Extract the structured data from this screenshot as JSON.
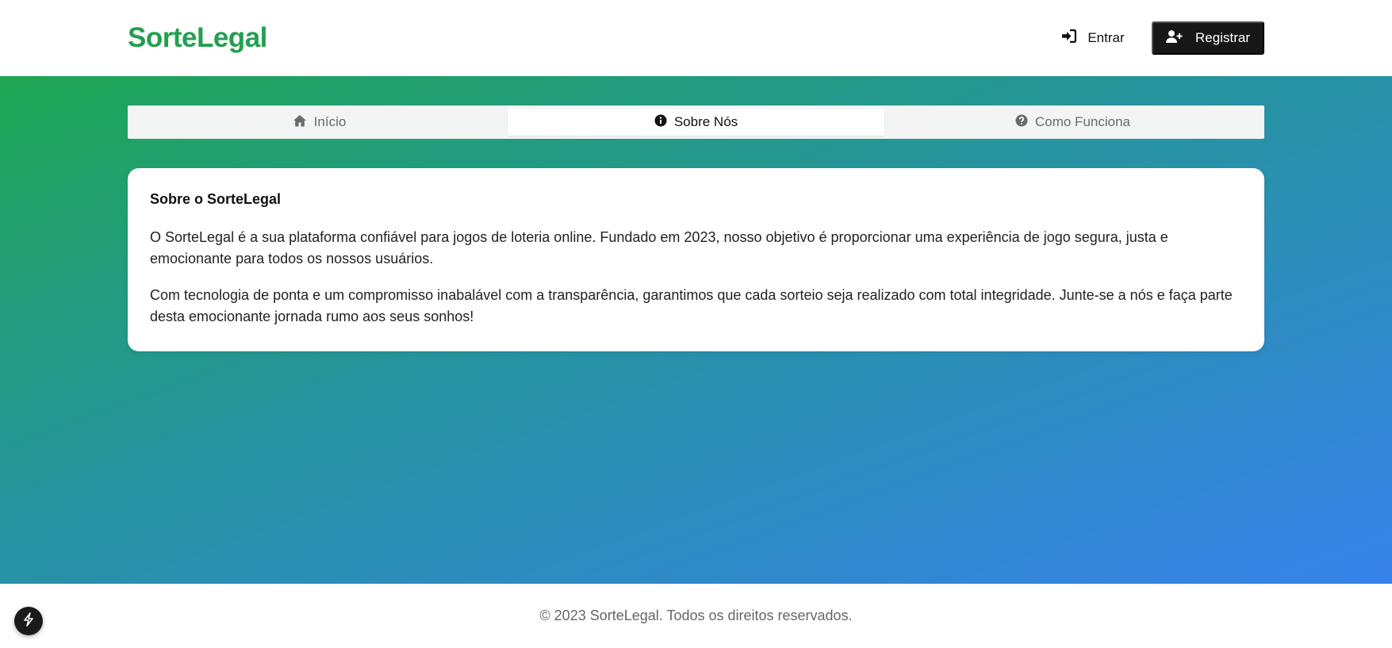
{
  "header": {
    "logo": "SorteLegal",
    "login_label": "Entrar",
    "register_label": "Registrar"
  },
  "tabs": [
    {
      "label": "Início",
      "icon": "home-icon",
      "active": false
    },
    {
      "label": "Sobre Nós",
      "icon": "info-icon",
      "active": true
    },
    {
      "label": "Como Funciona",
      "icon": "question-icon",
      "active": false
    }
  ],
  "card": {
    "title": "Sobre o SorteLegal",
    "paragraphs": [
      "O SorteLegal é a sua plataforma confiável para jogos de loteria online. Fundado em 2023, nosso objetivo é proporcionar uma experiência de jogo segura, justa e emocionante para todos os nossos usuários.",
      "Com tecnologia de ponta e um compromisso inabalável com a transparência, garantimos que cada sorteio seja realizado com total integridade. Junte-se a nós e faça parte desta emocionante jornada rumo aos seus sonhos!"
    ]
  },
  "footer": {
    "copyright": "© 2023 SorteLegal. Todos os direitos reservados."
  },
  "colors": {
    "brand": "#22a04f",
    "gradient_start": "#1ea653",
    "gradient_end": "#3782eb",
    "dark_button": "#171717"
  }
}
